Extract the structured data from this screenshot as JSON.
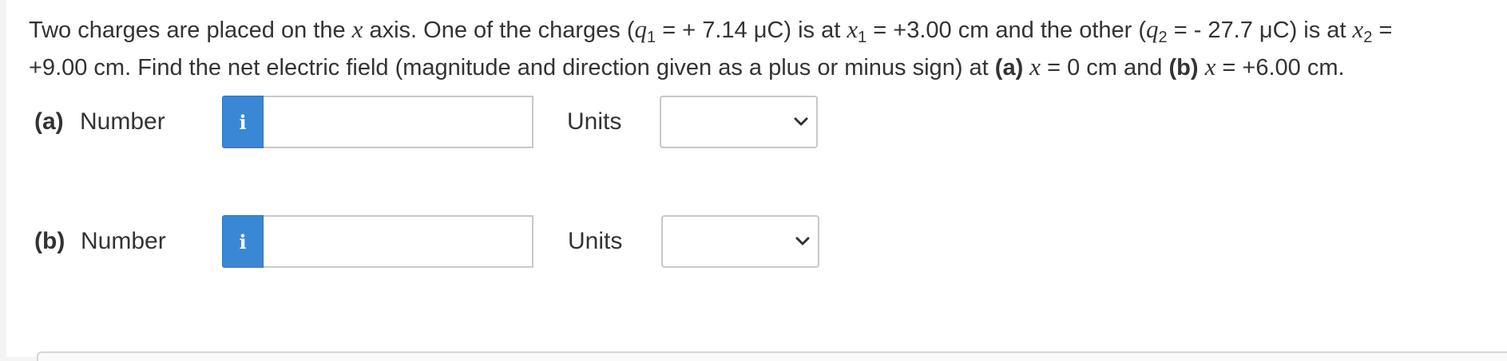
{
  "question": {
    "t1": "Two charges are placed on the ",
    "x1": "x",
    "t2": " axis. One of the charges (",
    "q1_sym": "q",
    "q1_sub": "1",
    "t3": " = + 7.14 μC) is at ",
    "x1_sym": "x",
    "x1_sub": "1",
    "t4": " = +3.00 cm and the other (",
    "q2_sym": "q",
    "q2_sub": "2",
    "t5": " = - 27.7 μC) is at ",
    "x2_sym": "x",
    "x2_sub": "2",
    "t6": " =",
    "t7": "+9.00 cm. Find the net electric field (magnitude and direction given as a plus or minus sign) at ",
    "a_label": "(a)",
    "t8": " ",
    "xa_sym": "x",
    "t9": " = 0 cm and ",
    "b_label": "(b)",
    "t10": " ",
    "xb_sym": "x",
    "t11": " = +6.00 cm."
  },
  "parts": [
    {
      "label": "(a)",
      "number_label": "Number",
      "info_icon": "i",
      "value": "",
      "units_label": "Units",
      "units_value": ""
    },
    {
      "label": "(b)",
      "number_label": "Number",
      "info_icon": "i",
      "value": "",
      "units_label": "Units",
      "units_value": ""
    }
  ],
  "colors": {
    "info_button": "#3a87d6",
    "border": "#c8c8c8",
    "text": "#333333"
  }
}
